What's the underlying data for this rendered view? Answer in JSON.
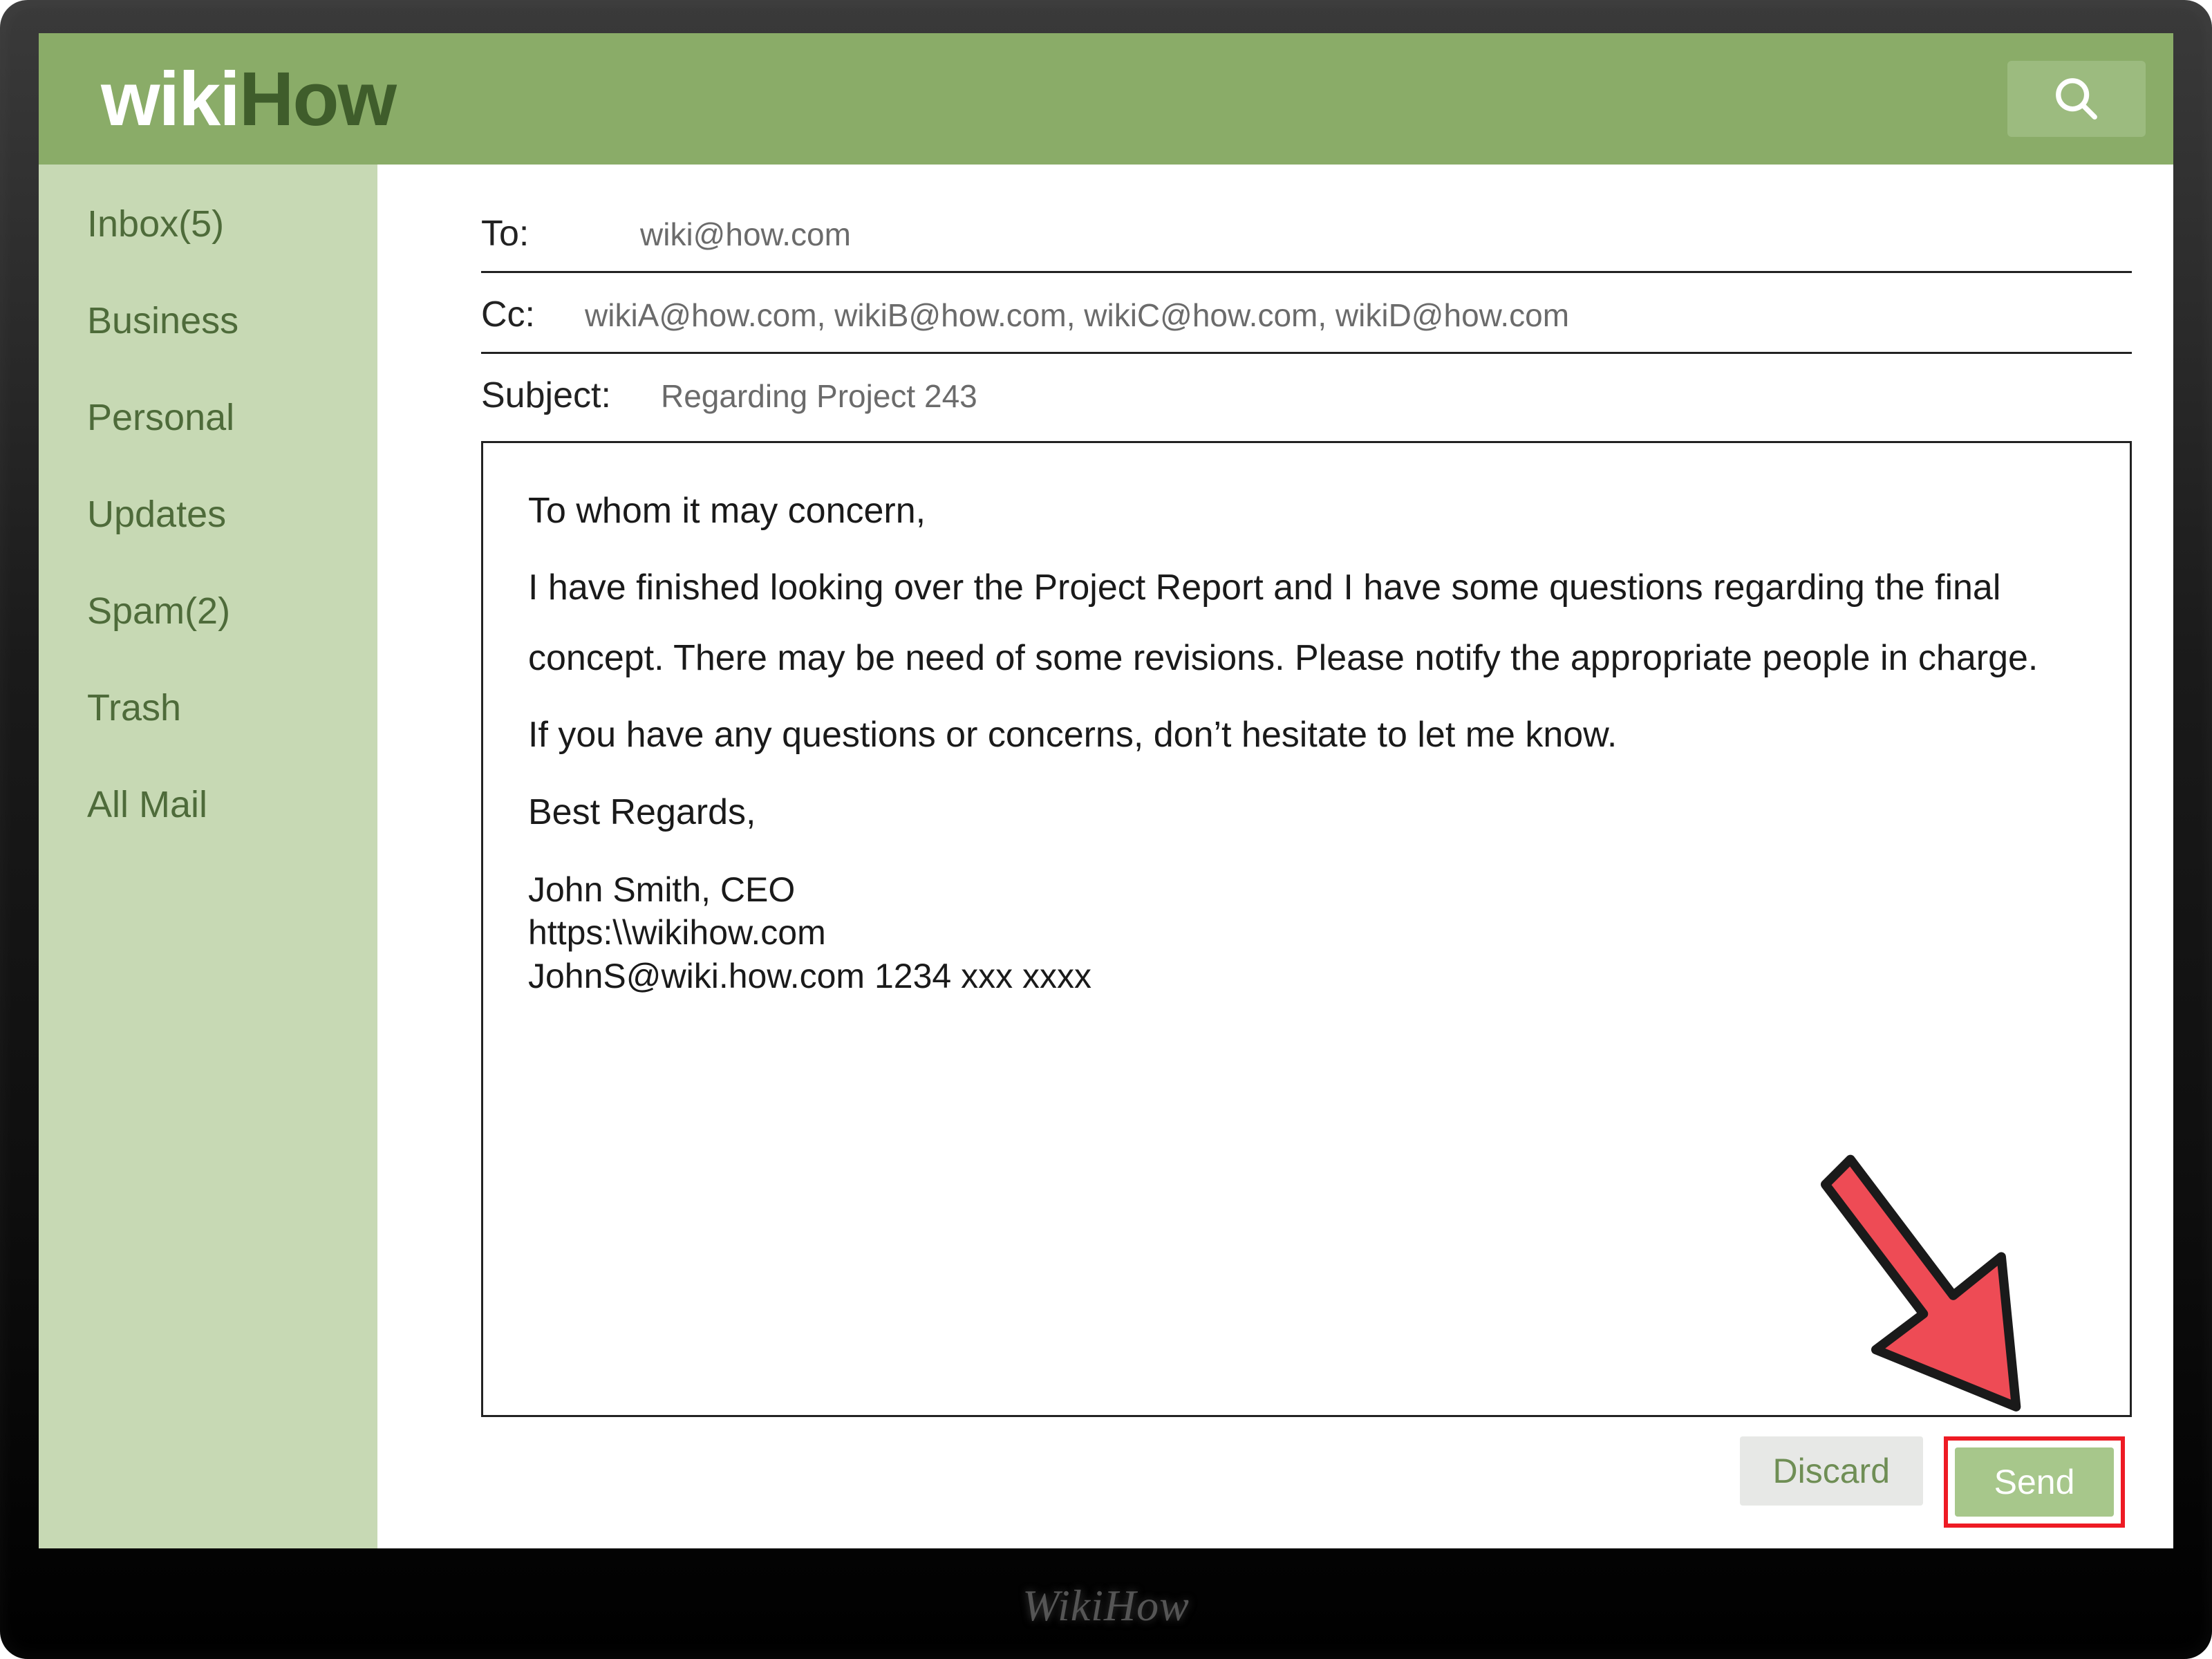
{
  "brand": {
    "part1": "wiki",
    "part2": "How"
  },
  "watermark": "WikiHow",
  "sidebar": {
    "items": [
      {
        "label": "Inbox(5)"
      },
      {
        "label": "Business"
      },
      {
        "label": "Personal"
      },
      {
        "label": "Updates"
      },
      {
        "label": "Spam(2)"
      },
      {
        "label": "Trash"
      },
      {
        "label": "All Mail"
      }
    ]
  },
  "compose": {
    "to_label": "To:",
    "to_value": "wiki@how.com",
    "cc_label": "Cc:",
    "cc_value": "wikiA@how.com, wikiB@how.com, wikiC@how.com, wikiD@how.com",
    "subject_label": "Subject:",
    "subject_value": "Regarding Project 243",
    "body": {
      "greeting": "To whom it may concern,",
      "p1": "I have finished looking over the Project Report and I have some questions regarding the final concept. There may be need of some revisions. Please notify the appropriate people in charge.",
      "p2": "If you have any questions or concerns, don’t hesitate to let me know.",
      "closing": "Best Regards,",
      "sig_name": "John Smith, CEO",
      "sig_url": "https:\\\\wikihow.com",
      "sig_contact": "JohnS@wiki.how.com  1234 xxx xxxx"
    }
  },
  "actions": {
    "discard": "Discard",
    "send": "Send"
  },
  "colors": {
    "header": "#8aac68",
    "sidebar": "#c7d9b4",
    "accent_arrow": "#ee4b55"
  }
}
